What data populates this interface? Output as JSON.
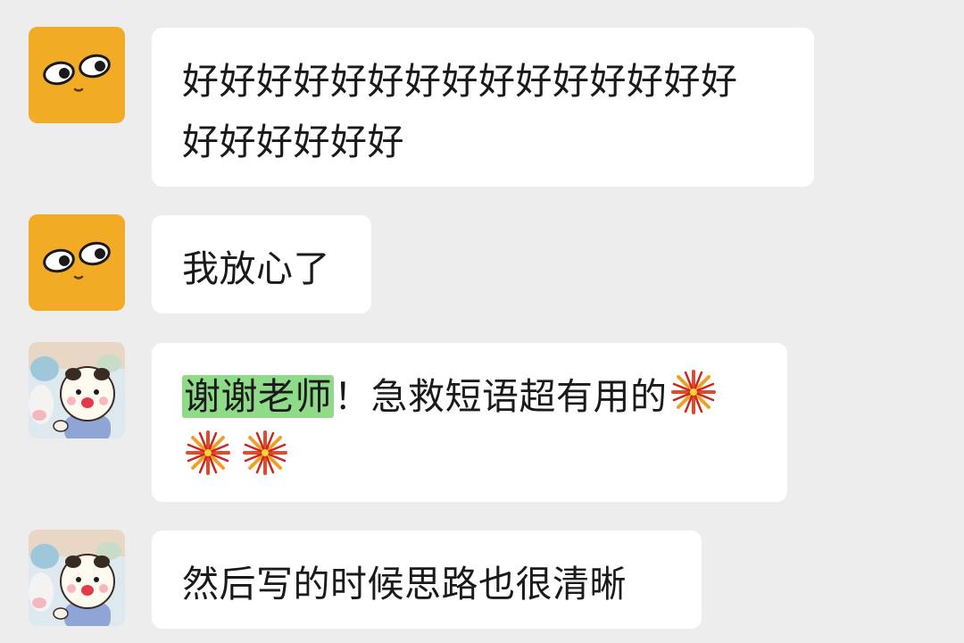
{
  "messages": [
    {
      "avatar": "orange-face-avatar",
      "line1": "好好好好好好好好好好好好好好好",
      "line2": "好好好好好好"
    },
    {
      "avatar": "orange-face-avatar",
      "text": "我放心了"
    },
    {
      "avatar": "bear-sticker-avatar",
      "highlight": "谢谢老师",
      "text": "！急救短语超有用的",
      "emojis": [
        "firework-emoji",
        "firework-emoji",
        "firework-emoji"
      ]
    },
    {
      "avatar": "bear-sticker-avatar",
      "text": "然后写的时候思路也很清晰"
    }
  ],
  "colors": {
    "background": "#ededed",
    "bubble": "#ffffff",
    "highlight": "#8fdb8a",
    "avatar_orange": "#f2ab25"
  }
}
